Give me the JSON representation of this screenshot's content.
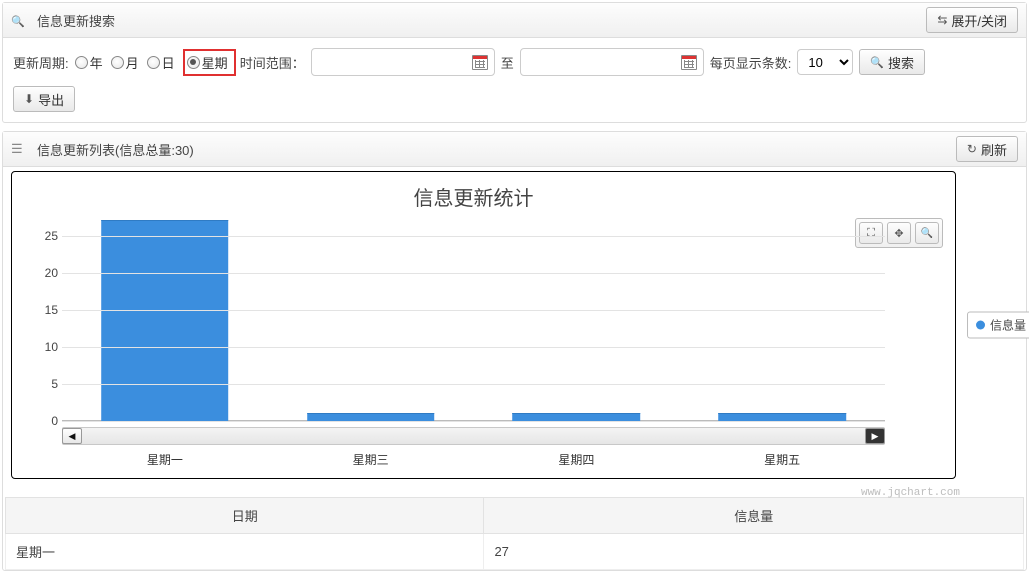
{
  "search_panel": {
    "title": "信息更新搜索",
    "toggle_label": "展开/关闭",
    "cycle_label": "更新周期:",
    "radios": {
      "year": "年",
      "month": "月",
      "day": "日",
      "week": "星期"
    },
    "selected_radio": "week",
    "time_range_label": "时间范围：",
    "to_label": "至",
    "per_page_label": "每页显示条数:",
    "per_page_value": "10",
    "search_button": "搜索",
    "export_button": "导出"
  },
  "list_panel": {
    "title": "信息更新列表(信息总量:30)",
    "info_total": 30,
    "refresh_label": "刷新"
  },
  "chart_data": {
    "type": "bar",
    "title": "信息更新统计",
    "categories": [
      "星期一",
      "星期三",
      "星期四",
      "星期五"
    ],
    "values": [
      27,
      1,
      1,
      1
    ],
    "series_name": "信息量",
    "ylim": [
      0,
      27
    ],
    "yticks": [
      0,
      5,
      10,
      15,
      20,
      25
    ],
    "xlabel": "",
    "ylabel": "",
    "watermark": "www.jqchart.com"
  },
  "table": {
    "col_date": "日期",
    "col_count": "信息量",
    "rows": [
      {
        "date": "星期一",
        "count": 27
      }
    ]
  }
}
